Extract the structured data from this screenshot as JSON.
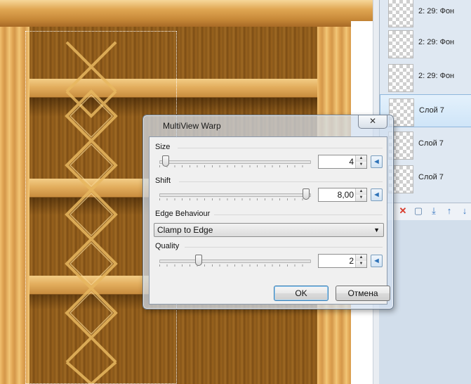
{
  "dialog": {
    "title": "MultiView Warp",
    "close_glyph": "✕",
    "size": {
      "label": "Size",
      "value": "4",
      "slider_fraction": 0.02
    },
    "shift": {
      "label": "Shift",
      "value": "8,00",
      "slider_fraction": 1.0
    },
    "edge": {
      "label": "Edge Behaviour",
      "selected": "Clamp to Edge"
    },
    "quality": {
      "label": "Quality",
      "value": "2",
      "slider_fraction": 0.25
    },
    "ok_label": "OK",
    "cancel_label": "Отмена"
  },
  "layers": {
    "items": [
      {
        "label": "2: 29: Фон",
        "selected": false
      },
      {
        "label": "2: 29: Фон",
        "selected": false
      },
      {
        "label": "2: 29: Фон",
        "selected": false
      },
      {
        "label": "Слой 7",
        "selected": true
      },
      {
        "label": "Слой 7",
        "selected": false
      },
      {
        "label": "Слой 7",
        "selected": false
      }
    ]
  },
  "colors": {
    "wood": "#d9a052",
    "accent": "#3c7fb1",
    "delete_icon": "#d83a2a"
  }
}
